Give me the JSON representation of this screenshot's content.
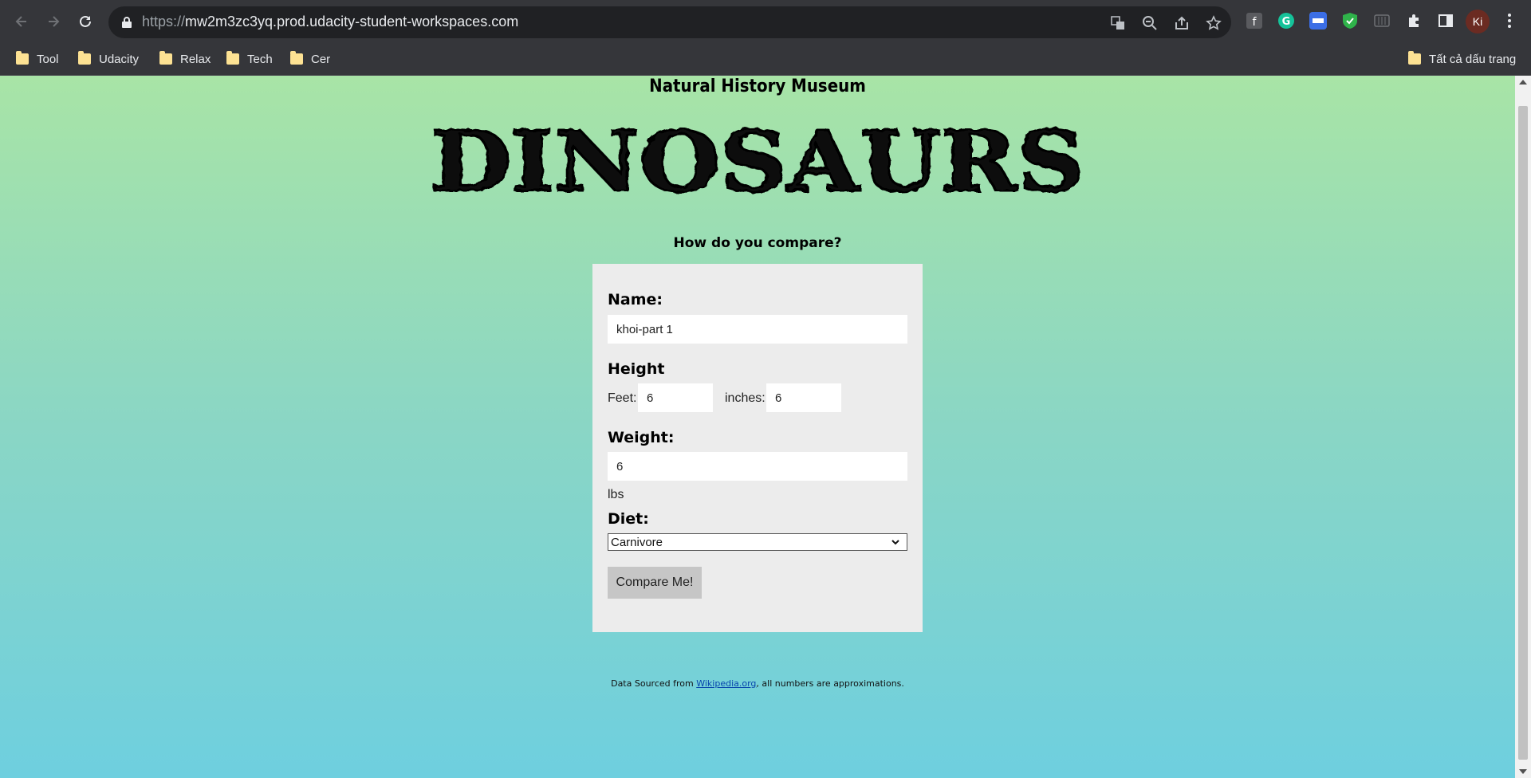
{
  "browser": {
    "url_scheme": "https://",
    "url_host": "mw2m3zc3yq.prod.udacity-student-workspaces.com",
    "profile_initials": "Ki",
    "bookmarks": [
      "Tool",
      "Udacity",
      "Relax",
      "Tech",
      "Cer"
    ],
    "all_bookmarks_label": "Tất cả dấu trang"
  },
  "page": {
    "museum_title": "Natural History Museum",
    "logo_text": "DINOSAURS",
    "compare_question": "How do you compare?",
    "form": {
      "name_label": "Name:",
      "name_value": "khoi-part 1",
      "height_label": "Height",
      "feet_label": "Feet:",
      "feet_value": "6",
      "inches_label": "inches:",
      "inches_value": "6",
      "weight_label": "Weight:",
      "weight_value": "6",
      "weight_unit": "lbs",
      "diet_label": "Diet:",
      "diet_value": "Carnivore",
      "submit_label": "Compare Me!"
    },
    "footer": {
      "prefix": "Data Sourced from ",
      "link_text": "Wikipedia.org",
      "suffix": ", all numbers are approximations."
    }
  },
  "colors": {
    "gradient_top": "#a8e4a6",
    "gradient_bottom": "#6ecfdf",
    "form_bg": "#ececec",
    "button_bg": "#c6c6c6"
  }
}
